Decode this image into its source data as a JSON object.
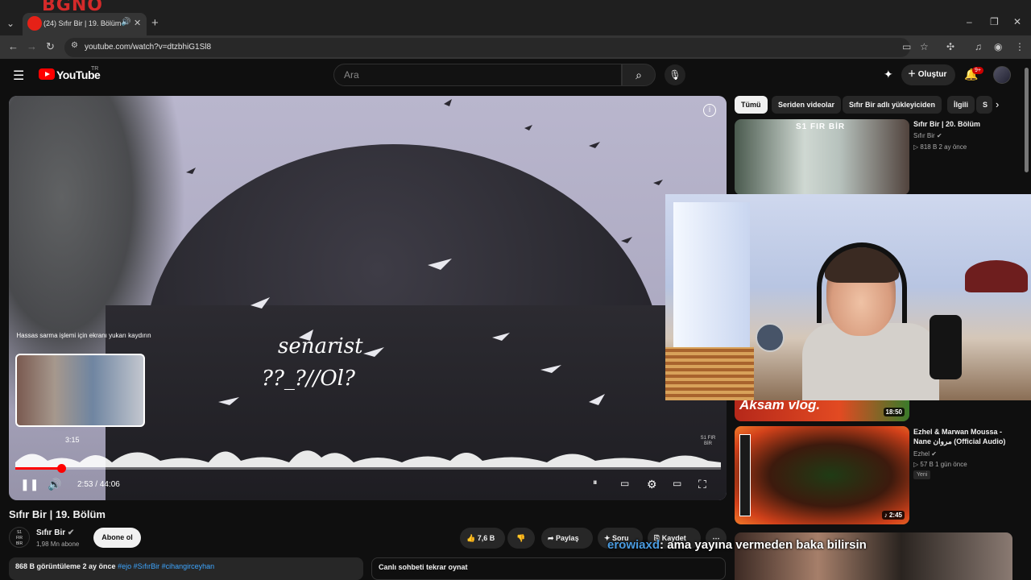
{
  "browser": {
    "tab_title": "(24) Sıfır Bir | 19. Bölüm - YouTube",
    "url": "youtube.com/watch?v=dtzbhiG1Sl8",
    "new_tab": "+",
    "logo_overlay_text": "BGNO"
  },
  "header": {
    "logo_text": "YouTube",
    "region": "TR",
    "search_placeholder": "Ara",
    "create_label": "Oluştur",
    "notification_count": "9+"
  },
  "player": {
    "doodle_line1": "senarist",
    "doodle_line2": "??_?//Ol?",
    "scroll_hint": "Hassas sarma işlemi için ekranı yukarı kaydırın",
    "preview_time": "3:15",
    "current_time": "2:53",
    "total_time": "44:06",
    "time_separator": " / ",
    "progress_fraction": 0.0655,
    "watermark": "S1 FIR BİR"
  },
  "video": {
    "title": "Sıfır Bir | 19. Bölüm",
    "channel_name": "Sıfır Bir",
    "subscribers": "1,98 Mn abone",
    "subscribe_label": "Abone ol",
    "likes": "7,6 B",
    "share_label": "Paylaş",
    "ask_label": "Soru",
    "save_label": "Kaydet",
    "description_stats": "868 B görüntüleme  2 ay önce",
    "description_tags": "#ejo #SıfırBir #cihangirceyhan",
    "chat_replay_label": "Canlı sohbeti tekrar oynat"
  },
  "sidebar": {
    "chips": [
      "Tümü",
      "Seriden videolar",
      "Sıfır Bir adlı yükleyiciden",
      "İlgili",
      "S"
    ],
    "recommendations": [
      {
        "title": "Sıfır Bir | 20. Bölüm",
        "channel": "Sıfır Bir",
        "meta": "818 B  2 ay önce",
        "thumb_text": "S1 FIR BİR"
      },
      {
        "title": "",
        "channel": "",
        "meta": "",
        "thumb_text": "Aksam vlog.",
        "duration": "18:50"
      },
      {
        "title": "Ezhel & Marwan Moussa - Nane مروان (Official Audio)",
        "channel": "Ezhel",
        "meta": "57 B  1 gün önce",
        "badge": "Yeni",
        "duration": "2:45"
      }
    ]
  },
  "chat_overlay": {
    "username": "erowiaxd",
    "message": ": ama yayına vermeden baka bilirsin"
  },
  "colors": {
    "accent": "#ff0000",
    "chat_user": "#4a9be0",
    "background": "#0f0f0f"
  },
  "icons": [
    "search-icon",
    "mic-icon",
    "bell-icon",
    "play-pause-icon",
    "volume-icon",
    "settings-icon",
    "fullscreen-icon",
    "like-icon",
    "dislike-icon",
    "share-icon",
    "more-icon"
  ]
}
